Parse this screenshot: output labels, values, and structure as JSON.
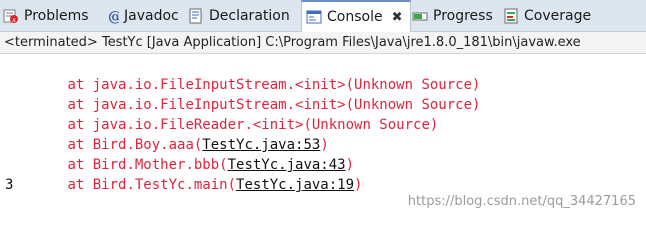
{
  "tabs": [
    {
      "label": "Problems",
      "icon": "problems-icon"
    },
    {
      "label": "Javadoc",
      "icon": "javadoc-icon"
    },
    {
      "label": "Declaration",
      "icon": "declaration-icon"
    },
    {
      "label": "Console",
      "icon": "console-icon",
      "active": true,
      "close": "✖"
    },
    {
      "label": "Progress",
      "icon": "progress-icon"
    },
    {
      "label": "Coverage",
      "icon": "coverage-icon"
    }
  ],
  "status": "<terminated> TestYc [Java Application] C:\\Program Files\\Java\\jre1.8.0_181\\bin\\javaw.exe",
  "console": {
    "lines": [
      {
        "indent": "\t",
        "text": "at java.io.FileInputStream.<init>(Unknown Source)"
      },
      {
        "indent": "\t",
        "text": "at java.io.FileInputStream.<init>(Unknown Source)"
      },
      {
        "indent": "\t",
        "text": "at java.io.FileReader.<init>(Unknown Source)"
      },
      {
        "indent": "\t",
        "prefix": "at Bird.Boy.aaa(",
        "link": "TestYc.java:53",
        "suffix": ")"
      },
      {
        "indent": "\t",
        "prefix": "at Bird.Mother.bbb(",
        "link": "TestYc.java:43",
        "suffix": ")"
      },
      {
        "indent": "\t",
        "prefix": "at Bird.TestYc.main(",
        "link": "TestYc.java:19",
        "suffix": ")"
      }
    ],
    "output": "3"
  },
  "watermark": "https://blog.csdn.net/qq_34427165",
  "colors": {
    "error": "#e0233c",
    "tab_bar": "#dde5ee",
    "active_tab_accent": "#6a8fc8"
  }
}
